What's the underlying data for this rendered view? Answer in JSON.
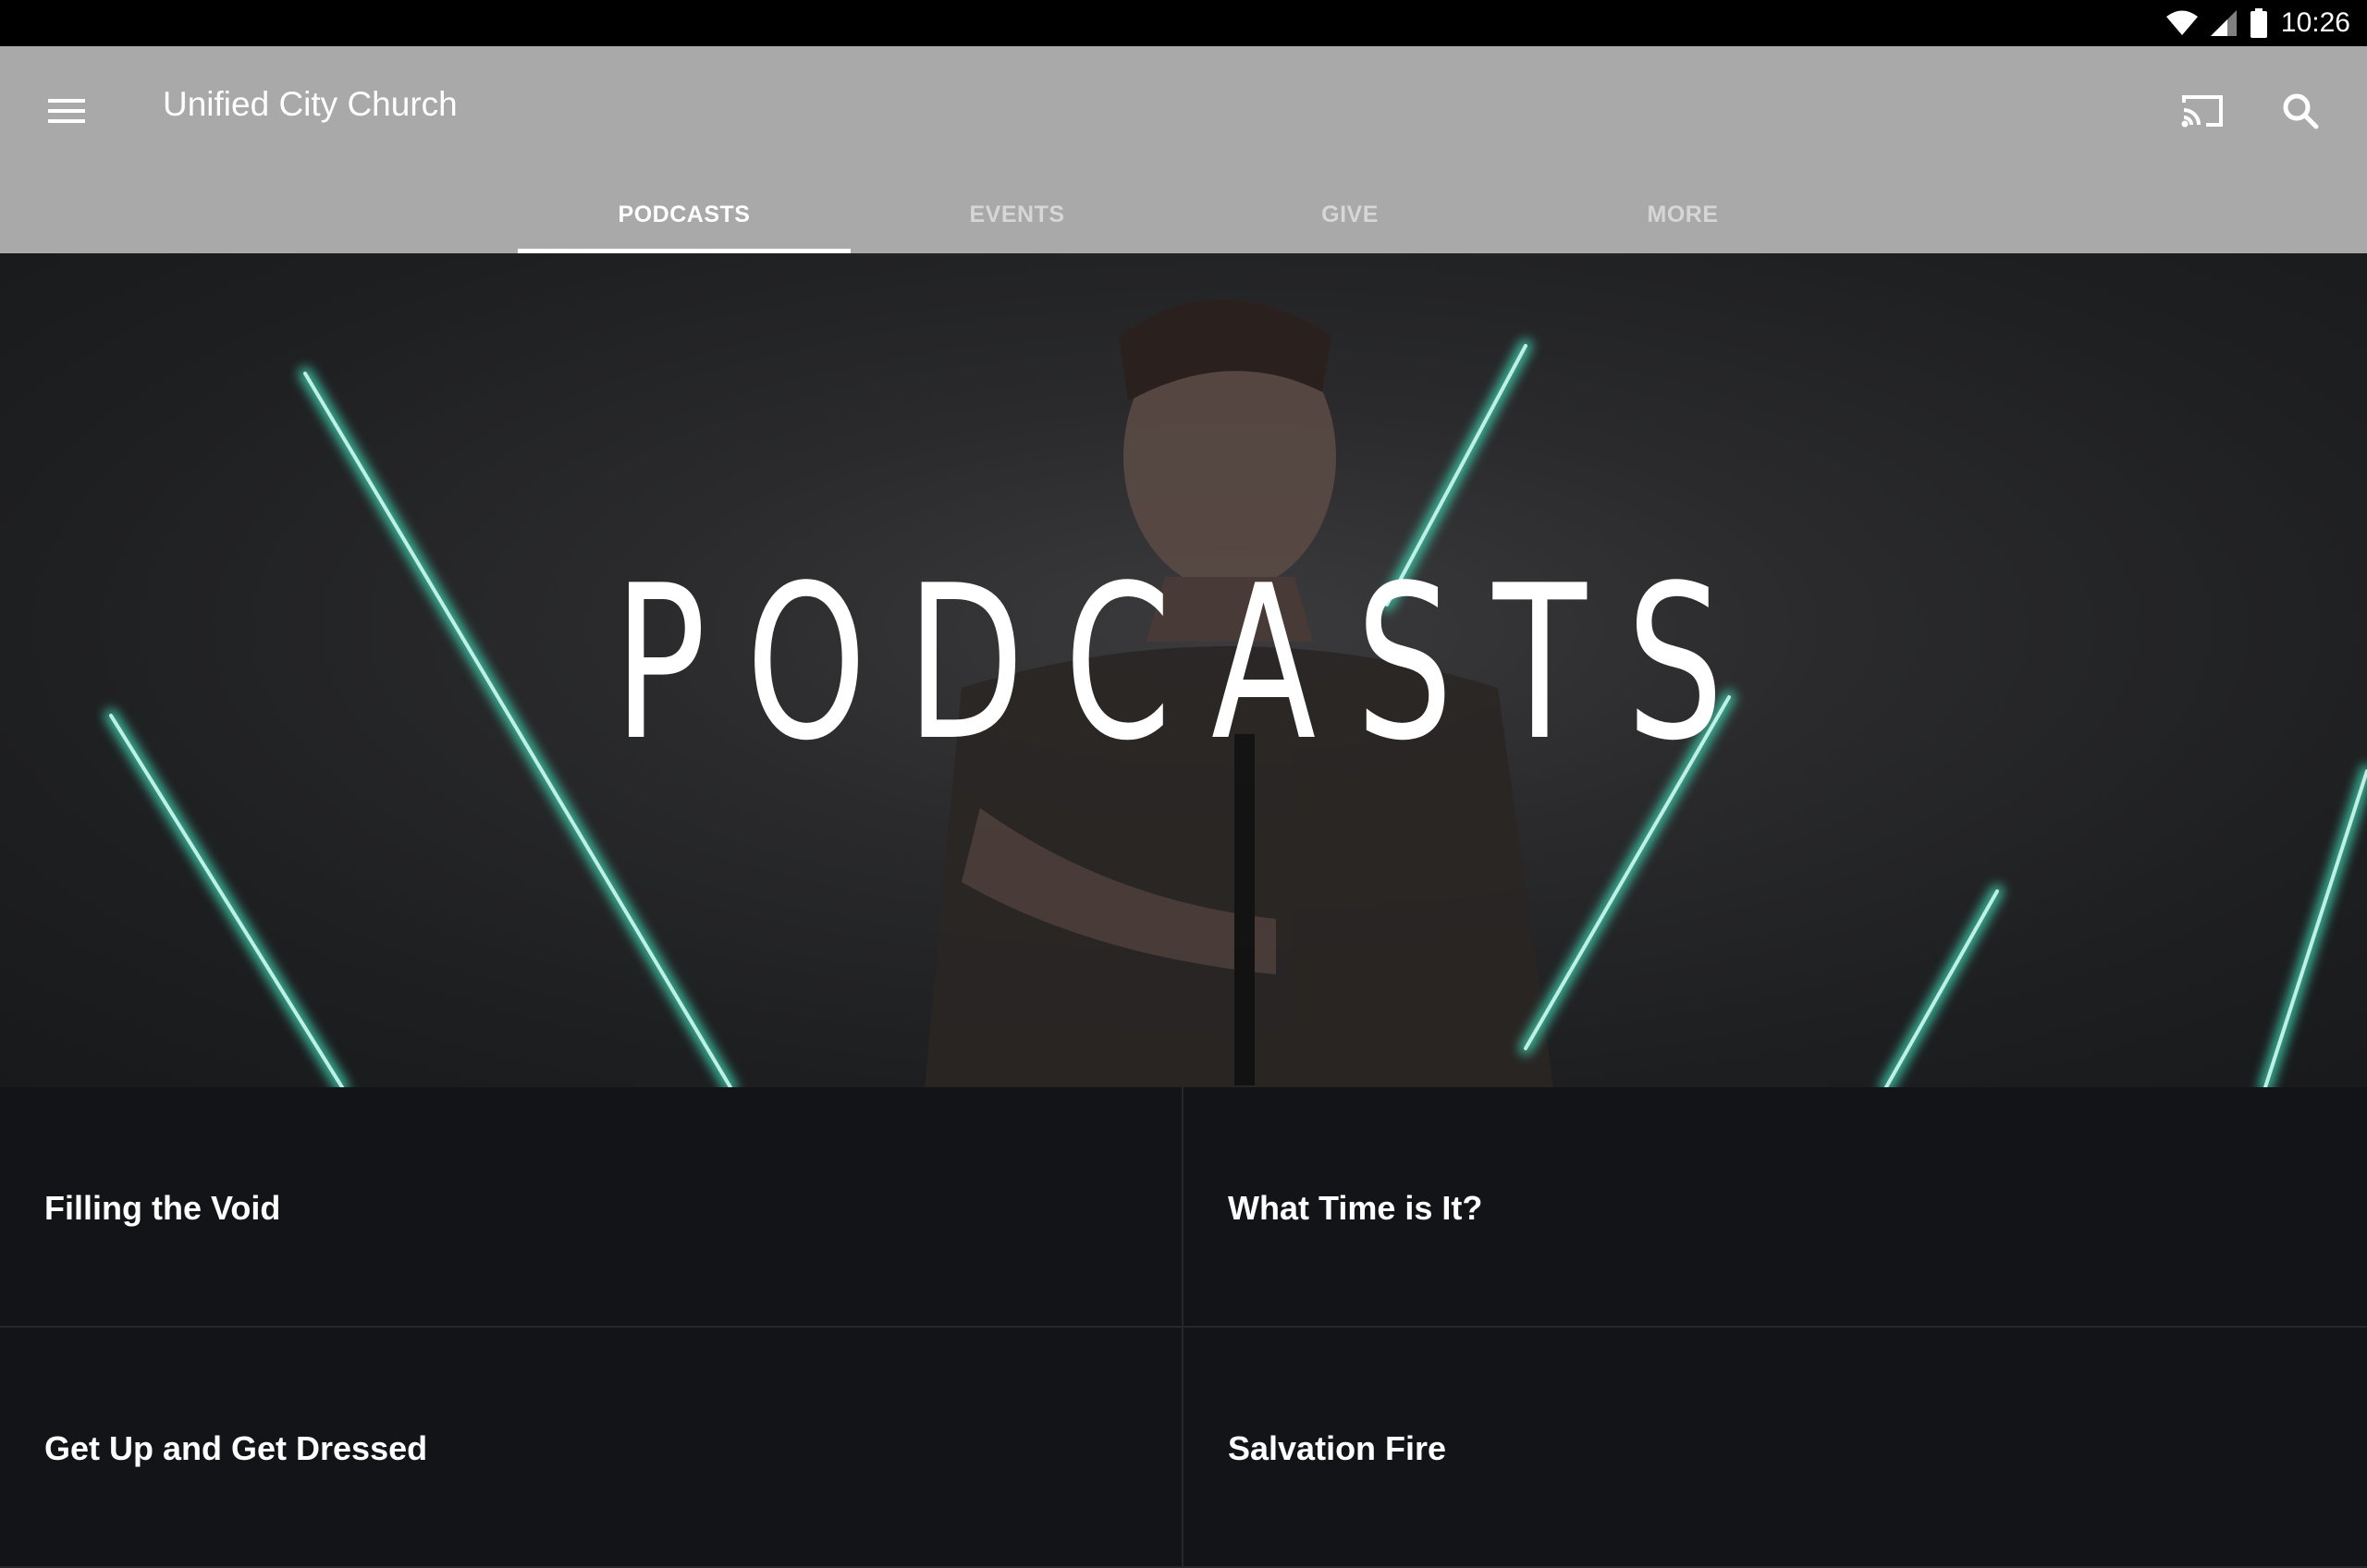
{
  "status_bar": {
    "time": "10:26",
    "icons": [
      "wifi-icon",
      "signal-icon",
      "battery-icon"
    ]
  },
  "app_bar": {
    "title": "Unified City Church",
    "background": "#a9a9a9",
    "icons": [
      "menu-icon",
      "cast-icon",
      "search-icon"
    ]
  },
  "tabs": [
    {
      "label": "PODCASTS",
      "active": true
    },
    {
      "label": "EVENTS",
      "active": false
    },
    {
      "label": "GIVE",
      "active": false
    },
    {
      "label": "MORE",
      "active": false
    }
  ],
  "hero": {
    "title": "PODCASTS",
    "accent": "#3fd6b4"
  },
  "podcasts": [
    {
      "title": "Filling the Void"
    },
    {
      "title": "What Time is It?"
    },
    {
      "title": "Get Up and Get Dressed"
    },
    {
      "title": "Salvation Fire"
    }
  ]
}
